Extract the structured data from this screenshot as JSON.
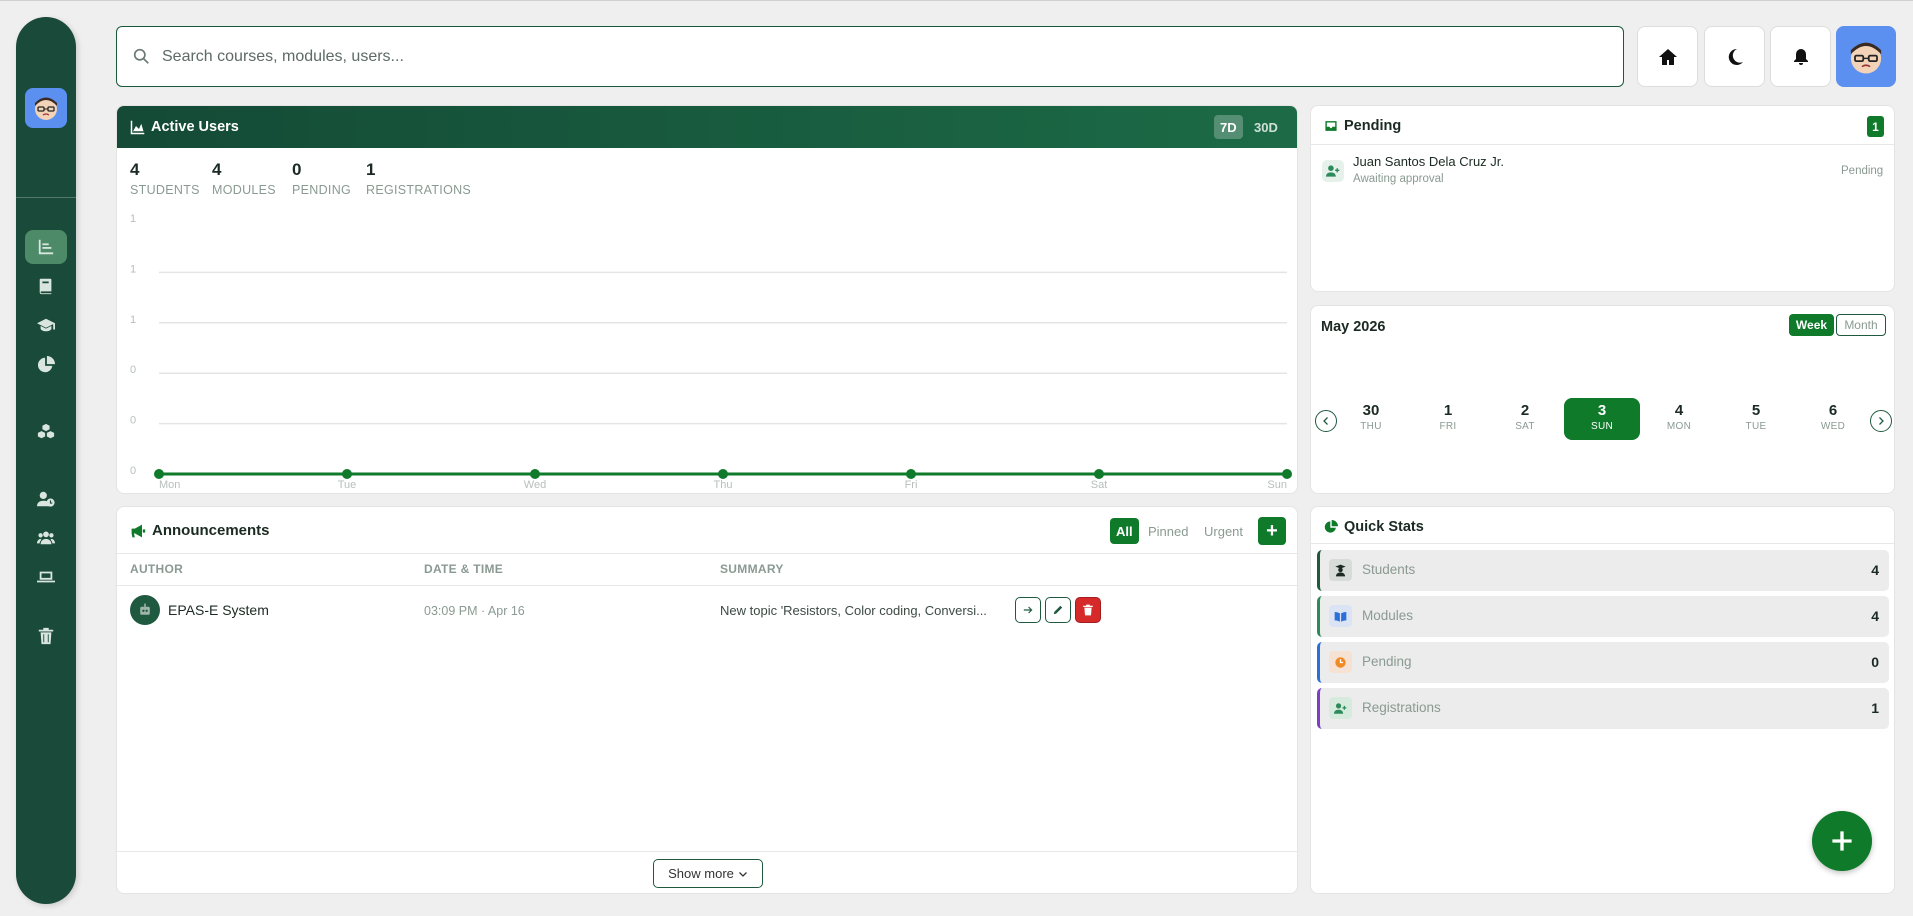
{
  "search": {
    "placeholder": "Search courses, modules, users..."
  },
  "header": {
    "buttons": [
      "home-icon",
      "moon-icon",
      "bell-icon"
    ]
  },
  "sidebar": {
    "items": [
      {
        "icon": "chart-icon",
        "active": true
      },
      {
        "icon": "book-icon"
      },
      {
        "icon": "graduation-cap-icon"
      },
      {
        "icon": "pie-chart-icon"
      },
      {
        "icon": "cubes-icon"
      },
      {
        "icon": "user-clock-icon"
      },
      {
        "icon": "users-icon"
      },
      {
        "icon": "laptop-icon"
      },
      {
        "icon": "trash-icon"
      }
    ]
  },
  "active_users": {
    "title": "Active Users",
    "ranges": [
      "7D",
      "30D"
    ],
    "selected_range": "7D",
    "stats": [
      {
        "value": "4",
        "label": "STUDENTS"
      },
      {
        "value": "4",
        "label": "MODULES"
      },
      {
        "value": "0",
        "label": "PENDING"
      },
      {
        "value": "1",
        "label": "REGISTRATIONS"
      }
    ]
  },
  "chart_data": {
    "type": "line",
    "categories": [
      "Mon",
      "Tue",
      "Wed",
      "Thu",
      "Fri",
      "Sat",
      "Sun"
    ],
    "y_tick_labels": [
      "1",
      "1",
      "1",
      "0",
      "0",
      "0"
    ],
    "series": [
      {
        "values": [
          0,
          0,
          0,
          0,
          0,
          0,
          0
        ]
      }
    ],
    "ylim": [
      0,
      1
    ],
    "grid": true,
    "color": "#0e7a2a"
  },
  "announcements": {
    "title": "Announcements",
    "filters": [
      "All",
      "Pinned",
      "Urgent"
    ],
    "active_filter": "All",
    "columns": [
      "AUTHOR",
      "DATE & TIME",
      "SUMMARY"
    ],
    "rows": [
      {
        "author": "EPAS-E System",
        "datetime": "03:09 PM · Apr 16",
        "summary": "New topic 'Resistors, Color coding, Conversi..."
      }
    ],
    "show_more": "Show more"
  },
  "pending": {
    "title": "Pending",
    "count": "1",
    "items": [
      {
        "name": "Juan Santos Dela Cruz Jr.",
        "subtitle": "Awaiting approval",
        "status": "Pending"
      }
    ]
  },
  "calendar": {
    "title": "May 2026",
    "views": [
      "Week",
      "Month"
    ],
    "active_view": "Week",
    "days": [
      {
        "date": "30",
        "weekday": "THU"
      },
      {
        "date": "1",
        "weekday": "FRI"
      },
      {
        "date": "2",
        "weekday": "SAT"
      },
      {
        "date": "3",
        "weekday": "SUN",
        "active": true
      },
      {
        "date": "4",
        "weekday": "MON"
      },
      {
        "date": "5",
        "weekday": "TUE"
      },
      {
        "date": "6",
        "weekday": "WED"
      }
    ]
  },
  "quick_stats": {
    "title": "Quick Stats",
    "items": [
      {
        "label": "Students",
        "value": "4",
        "icon": "user-graduate-icon",
        "accent": "#1f5a40"
      },
      {
        "label": "Modules",
        "value": "4",
        "icon": "book-open-icon",
        "accent": "#2d8a5a"
      },
      {
        "label": "Pending",
        "value": "0",
        "icon": "clock-icon",
        "accent": "#2d6fd8"
      },
      {
        "label": "Registrations",
        "value": "1",
        "icon": "user-plus-icon",
        "accent": "#7b3fc4"
      }
    ]
  },
  "colors": {
    "primary": "#0e7a2a",
    "sidebar": "#1a4a3a",
    "accent_blue": "#5b8ff0"
  }
}
